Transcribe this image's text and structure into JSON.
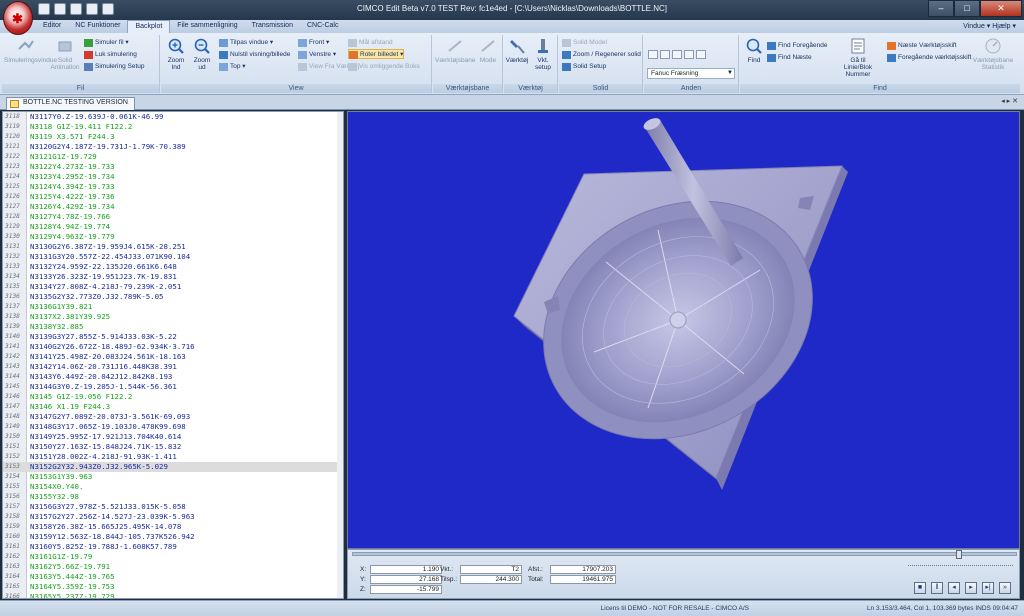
{
  "window": {
    "title": "CIMCO Edit Beta v7.0 TEST Rev: fc1e4ed - [C:\\Users\\Nicklas\\Downloads\\BOTTLE.NC]",
    "help": "Vindue ▾  Hjælp ▾"
  },
  "tabs": [
    {
      "label": "Editor"
    },
    {
      "label": "NC Funktioner"
    },
    {
      "label": "Backplot"
    },
    {
      "label": "File sammenligning"
    },
    {
      "label": "Transmission"
    },
    {
      "label": "CNC-Calc"
    }
  ],
  "ribbon": {
    "fil": {
      "label": "Fil",
      "simuleringsvindue": "Simuleringsvindue",
      "solid_animation": "Solid Animation",
      "simuler_fil": "Simuler fil ▾",
      "luk_simulering": "Luk simulering",
      "simulering_setup": "Simulering Setup"
    },
    "view": {
      "label": "View",
      "zoom_ind": "Zoom Ind",
      "zoom_ud": "Zoom ud",
      "tilpas_vindue": "Tilpas vindue ▾",
      "nulstil_visning": "Nulstil visning/billede",
      "top": "Top ▾",
      "front": "Front ▾",
      "venstre": "Venstre ▾",
      "view_fra_vaerktoej": "View Fra Værktøj",
      "maal_afstand": "Mål afstand",
      "roter_billedet": "Roter billedet ▾",
      "vis_omliggende": "Vis omliggende Boks"
    },
    "vaerktoejsbane": {
      "label": "Værktøjsbane",
      "vaerktoejsbane": "Værktøjsbane",
      "mode": "Mode"
    },
    "vaerktoej": {
      "label": "Værktøj",
      "vaerktoej": "Værktøj",
      "vkt_setup": "Vkt. setup"
    },
    "solid": {
      "label": "Solid",
      "solid_model": "Solid Model",
      "zoom_regenerer": "Zoom / Regenerer solid",
      "solid_setup": "Solid Setup"
    },
    "anden": {
      "label": "Anden",
      "control": "Fanuc Fræsning"
    },
    "find": {
      "label": "Find",
      "find": "Find",
      "find_foregaaende": "Find Foregående",
      "find_naeste": "Find Næste",
      "gaa_til": "Gå til Linie/Blok Nummer",
      "naeste_vaerktoejsskift": "Næste Værktøjsskift",
      "foregaaende_vaerktoejsskift": "Foregående værktøjsskift",
      "vaerktoejsbane_statistik": "Værktøjsbane Statistik"
    }
  },
  "document_tab": "BOTTLE.NC TESTING VERSION",
  "doc_nav": "◂ ▸ ✕",
  "code_lines": [
    {
      "n": "3118",
      "t": "N3117Y0.Z-19.639J-0.061K-46.99",
      "c": "blue"
    },
    {
      "n": "3119",
      "t": "N3118 G1Z-19.411 F122.2",
      "c": "green"
    },
    {
      "n": "3120",
      "t": "N3119 X3.571 F244.3",
      "c": "green"
    },
    {
      "n": "3121",
      "t": "N3120G2Y4.187Z-19.731J-1.79K-70.389",
      "c": "blue"
    },
    {
      "n": "3122",
      "t": "N3121G1Z-19.729",
      "c": "green"
    },
    {
      "n": "3123",
      "t": "N3122Y4.273Z-19.733",
      "c": "green"
    },
    {
      "n": "3124",
      "t": "N3123Y4.295Z-19.734",
      "c": "green"
    },
    {
      "n": "3125",
      "t": "N3124Y4.394Z-19.733",
      "c": "green"
    },
    {
      "n": "3126",
      "t": "N3125Y4.422Z-19.736",
      "c": "green"
    },
    {
      "n": "3127",
      "t": "N3126Y4.429Z-19.734",
      "c": "green"
    },
    {
      "n": "3128",
      "t": "N3127Y4.78Z-19.766",
      "c": "green"
    },
    {
      "n": "3129",
      "t": "N3128Y4.94Z-19.774",
      "c": "green"
    },
    {
      "n": "3130",
      "t": "N3129Y4.963Z-19.779",
      "c": "green"
    },
    {
      "n": "3131",
      "t": "N3130G2Y6.387Z-19.959J4.615K-28.251",
      "c": "blue"
    },
    {
      "n": "3132",
      "t": "N3131G3Y20.557Z-22.454J33.071K90.104",
      "c": "blue"
    },
    {
      "n": "3133",
      "t": "N3132Y24.959Z-22.135J20.661K6.648",
      "c": "blue"
    },
    {
      "n": "3134",
      "t": "N3133Y26.323Z-19.951J23.7K-19.831",
      "c": "blue"
    },
    {
      "n": "3135",
      "t": "N3134Y27.808Z-4.218J-79.239K-2.051",
      "c": "blue"
    },
    {
      "n": "3136",
      "t": "N3135G2Y32.773Z0.J32.789K-5.05",
      "c": "blue"
    },
    {
      "n": "3137",
      "t": "N3136G1Y39.821",
      "c": "green"
    },
    {
      "n": "3138",
      "t": "N3137X2.381Y39.925",
      "c": "green"
    },
    {
      "n": "3139",
      "t": "N3138Y32.885",
      "c": "green"
    },
    {
      "n": "3140",
      "t": "N3139G3Y27.855Z-5.914J33.03K-5.22",
      "c": "blue"
    },
    {
      "n": "3141",
      "t": "N3140G2Y26.672Z-18.489J-62.934K-3.716",
      "c": "blue"
    },
    {
      "n": "3142",
      "t": "N3141Y25.498Z-20.083J24.561K-18.163",
      "c": "blue"
    },
    {
      "n": "3143",
      "t": "N3142Y14.06Z-20.731J16.448K38.391",
      "c": "blue"
    },
    {
      "n": "3144",
      "t": "N3143Y6.449Z-20.042J12.842K8.193",
      "c": "blue"
    },
    {
      "n": "3145",
      "t": "N3144G3Y0.Z-19.205J-1.544K-56.361",
      "c": "blue"
    },
    {
      "n": "3146",
      "t": "N3145 G1Z-19.056 F122.2",
      "c": "green"
    },
    {
      "n": "3147",
      "t": "N3146 X1.19 F244.3",
      "c": "green"
    },
    {
      "n": "3148",
      "t": "N3147G2Y7.089Z-20.073J-3.561K-69.093",
      "c": "blue"
    },
    {
      "n": "3149",
      "t": "N3148G3Y17.065Z-19.103J0.478K99.698",
      "c": "blue"
    },
    {
      "n": "3150",
      "t": "N3149Y25.995Z-17.921J13.704K40.614",
      "c": "blue"
    },
    {
      "n": "3151",
      "t": "N3150Y27.163Z-15.848J24.71K-15.832",
      "c": "blue"
    },
    {
      "n": "3152",
      "t": "N3151Y28.002Z-4.218J-91.93K-1.411",
      "c": "blue"
    },
    {
      "n": "3153",
      "t": "N3152G2Y32.943Z0.J32.965K-5.029",
      "c": "blue",
      "sel": true
    },
    {
      "n": "3154",
      "t": "N3153G1Y39.963",
      "c": "green"
    },
    {
      "n": "3155",
      "t": "N3154X0.Y40.",
      "c": "green"
    },
    {
      "n": "3156",
      "t": "N3155Y32.98",
      "c": "green"
    },
    {
      "n": "3157",
      "t": "N3156G3Y27.978Z-5.521J33.015K-5.058",
      "c": "blue"
    },
    {
      "n": "3158",
      "t": "N3157G2Y27.256Z-14.527J-23.039K-5.963",
      "c": "blue"
    },
    {
      "n": "3159",
      "t": "N3158Y26.38Z-15.665J25.495K-14.078",
      "c": "blue"
    },
    {
      "n": "3160",
      "t": "N3159Y12.563Z-18.844J-105.737K526.942",
      "c": "blue"
    },
    {
      "n": "3161",
      "t": "N3160Y5.825Z-19.788J-1.608K57.789",
      "c": "blue"
    },
    {
      "n": "3162",
      "t": "N3161G1Z-19.79",
      "c": "green"
    },
    {
      "n": "3163",
      "t": "N3162Y5.66Z-19.791",
      "c": "green"
    },
    {
      "n": "3164",
      "t": "N3163Y5.444Z-19.765",
      "c": "green"
    },
    {
      "n": "3165",
      "t": "N3164Y5.359Z-19.753",
      "c": "green"
    },
    {
      "n": "3166",
      "t": "N3165Y5.237Z-19.729",
      "c": "green"
    }
  ],
  "readouts": {
    "x_label": "X:",
    "x": "1.190",
    "y_label": "Y:",
    "y": "27.168",
    "z_label": "Z:",
    "z": "-15.799",
    "vkt_label": "Vkt.:",
    "vkt": "T2",
    "tilsp_label": "Tilsp.:",
    "tilsp": "244.300",
    "afst_label": "Afst.:",
    "afst": "17907.203",
    "total_label": "Total:",
    "total": "19461.975"
  },
  "status": {
    "license": "Licens til DEMO - NOT FOR RESALE - CIMCO A/S",
    "position": "Ln 3.153/3.464, Col 1, 103.369 bytes  INDS  09:04:47"
  },
  "colors": {
    "viewport_bg": "#1f29c7",
    "part": "#9a9ac8",
    "code_blue": "#1b2b9e",
    "code_green": "#17a41c"
  }
}
